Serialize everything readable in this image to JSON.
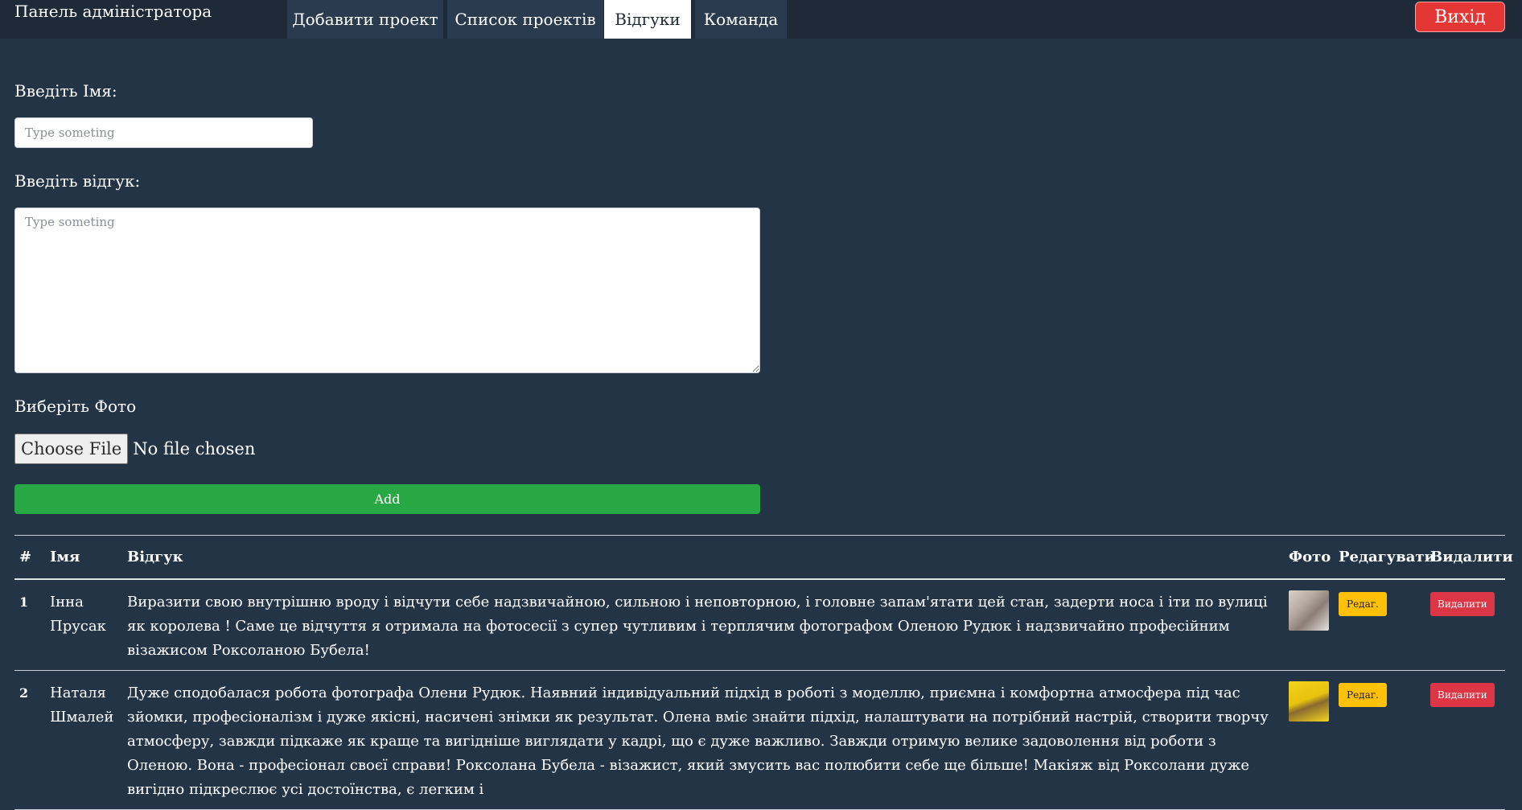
{
  "header": {
    "brand": "Панель адміністратора",
    "tabs": [
      {
        "label": "Добавити проект",
        "active": false
      },
      {
        "label": "Список проектів",
        "active": false
      },
      {
        "label": "Відгуки",
        "active": true
      },
      {
        "label": "Команда",
        "active": false
      }
    ],
    "logout_label": "Вихід"
  },
  "form": {
    "name_label": "Введіть Імя:",
    "name_placeholder": "Type someting",
    "name_value": "",
    "review_label": "Введіть відгук:",
    "review_placeholder": "Type someting",
    "review_value": "",
    "photo_label": "Виберіть Фото",
    "file_button": "Choose File",
    "file_status": "No file chosen",
    "add_label": "Add"
  },
  "table": {
    "headers": [
      "#",
      "Імя",
      "Відгук",
      "Фото",
      "Редагувати",
      "Видалити"
    ],
    "rows": [
      {
        "num": "1",
        "name": "Інна Прусак",
        "review": "Виразити свою внутрішню вроду і відчути себе надзвичайною, сильною і неповторною, і головне запам'ятати цей стан, задерти носа і іти по вулиці як королева ! Саме це відчуття я отримала на фотосесії з супер чутливим і терплячим фотографом Оленою Рудюк і надзвичайно професійним візажисом Роксоланою Бубела!",
        "photo_icon": "photo-thumbnail",
        "edit_label": "Редаг.",
        "delete_label": "Видалити"
      },
      {
        "num": "2",
        "name": "Наталя Шмалей",
        "review": "Дуже сподобалася робота фотографа Олени Рудюк. Наявний індивідуальний підхід в роботі з моделлю, приємна і комфортна атмосфера під час зйомки, професіоналізм і дуже якісні, насичені знімки як результат. Олена вміє знайти підхід, налаштувати на потрібний настрій, створити творчу атмосферу, завжди підкаже як краще та вигідніше виглядати у кадрі, що є дуже важливо. Завжди отримую велике задоволення від роботи з Оленою. Вона - професіонал своєї справи! Роксолана Бубела - візажист, який змусить вас полюбити себе ще більше! Макіяж від Роксолани дуже вигідно підкреслює усі достоїнства, є легким і",
        "photo_icon": "photo-thumbnail",
        "edit_label": "Редаг.",
        "delete_label": "Видалити"
      }
    ]
  },
  "colors": {
    "background": "#243447",
    "topbar": "#1e2a38",
    "tab": "#2b3b4f",
    "logout": "#e53636",
    "add": "#28a745",
    "edit": "#ffc107",
    "delete": "#dc3545"
  }
}
